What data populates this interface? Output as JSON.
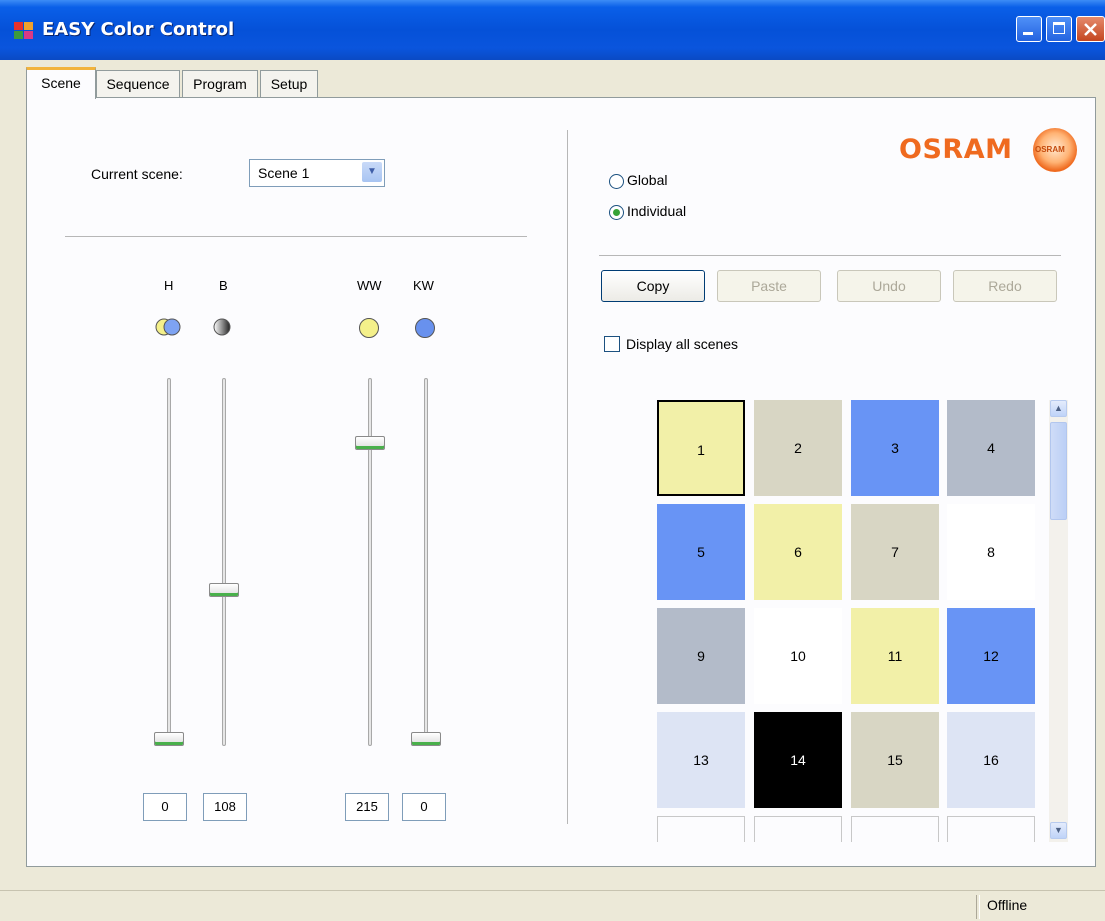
{
  "window": {
    "title": "EASY Color Control"
  },
  "tabs": [
    "Scene",
    "Sequence",
    "Program",
    "Setup"
  ],
  "scene": {
    "current_label": "Current scene:",
    "current_value": "Scene 1",
    "mode": {
      "global_label": "Global",
      "individual_label": "Individual",
      "selected": "individual"
    },
    "sliders": [
      {
        "label": "H",
        "value": "0",
        "level": 0.0,
        "icon": "hue-icon"
      },
      {
        "label": "B",
        "value": "108",
        "level": 0.43,
        "icon": "brightness-icon"
      },
      {
        "label": "WW",
        "value": "215",
        "level": 0.84,
        "icon": "warm-white-icon"
      },
      {
        "label": "KW",
        "value": "0",
        "level": 0.0,
        "icon": "cool-white-icon"
      }
    ],
    "buttons": {
      "copy": "Copy",
      "paste": "Paste",
      "undo": "Undo",
      "redo": "Redo"
    },
    "display_all_label": "Display all scenes",
    "grid": [
      {
        "num": "1",
        "color": "#f2f0a8"
      },
      {
        "num": "2",
        "color": "#d8d6c4"
      },
      {
        "num": "3",
        "color": "#6894f5"
      },
      {
        "num": "4",
        "color": "#b3bbc9"
      },
      {
        "num": "5",
        "color": "#6894f5"
      },
      {
        "num": "6",
        "color": "#f2f0a8"
      },
      {
        "num": "7",
        "color": "#d8d6c4"
      },
      {
        "num": "8",
        "color": "#ffffff"
      },
      {
        "num": "9",
        "color": "#b3bbc9"
      },
      {
        "num": "10",
        "color": "#ffffff"
      },
      {
        "num": "11",
        "color": "#f2f0a8"
      },
      {
        "num": "12",
        "color": "#6894f5"
      },
      {
        "num": "13",
        "color": "#dde4f4"
      },
      {
        "num": "14",
        "color": "#000000"
      },
      {
        "num": "15",
        "color": "#d8d6c4"
      },
      {
        "num": "16",
        "color": "#dde4f4"
      }
    ]
  },
  "logo": {
    "text": "OSRAM",
    "bulb_text": "OSRAM"
  },
  "status": {
    "text": "Offline"
  }
}
